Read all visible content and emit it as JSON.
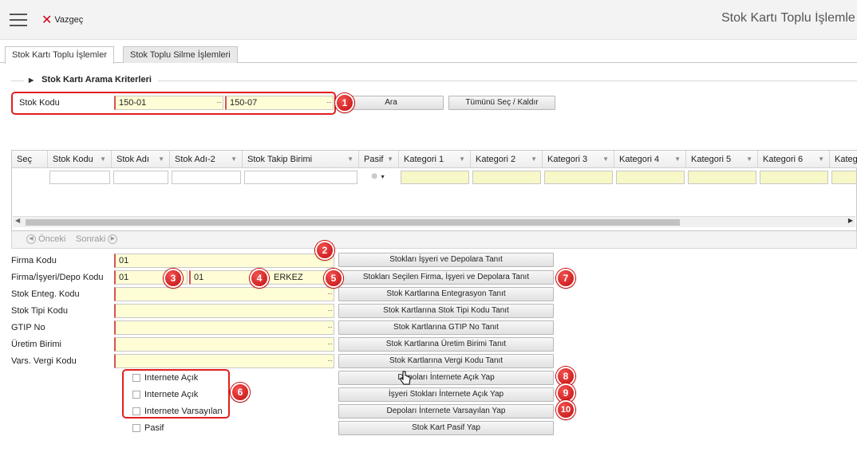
{
  "header": {
    "cancel_label": "Vazgeç",
    "title": "Stok Kartı Toplu İşlemle"
  },
  "tabs": [
    {
      "label": "Stok Kartı Toplu İşlemler",
      "active": true
    },
    {
      "label": "Stok Toplu Silme İşlemleri",
      "active": false
    }
  ],
  "search": {
    "section_title": "Stok Kartı Arama Kriterleri",
    "stok_kodu_label": "Stok Kodu",
    "stok_kodu_from": "150-01",
    "stok_kodu_to": "150-07",
    "search_button": "Ara",
    "select_all_button": "Tümünü Seç / Kaldır"
  },
  "grid": {
    "columns": [
      "Seç",
      "Stok Kodu",
      "Stok Adı",
      "Stok Adı-2",
      "Stok Takip Birimi",
      "Pasif",
      "Kategori 1",
      "Kategori 2",
      "Kategori 3",
      "Kategori 4",
      "Kategori 5",
      "Kategori 6",
      "Kateg"
    ],
    "prev_label": "Önceki",
    "next_label": "Sonraki"
  },
  "form": {
    "firma_kodu_label": "Firma Kodu",
    "firma_kodu_value": "01",
    "firma_isyeri_depo_label": "Firma/İşyeri/Depo Kodu",
    "firma_value": "01",
    "isyeri_value": "01",
    "depo_value": "ERKEZ",
    "stok_enteg_label": "Stok Enteg. Kodu",
    "stok_tipi_label": "Stok Tipi Kodu",
    "gtip_label": "GTIP No",
    "uretim_birimi_label": "Üretim Birimi",
    "vars_vergi_label": "Vars. Vergi Kodu"
  },
  "checkboxes": [
    "Internete Açık",
    "Internete Açık",
    "Internete Varsayılan",
    "Pasif"
  ],
  "actions": [
    "Stokları İşyeri ve Depolara Tanıt",
    "Stokları Seçilen Firma, İşyeri ve Depolara Tanıt",
    "Stok Kartlarına Entegrasyon Tanıt",
    "Stok Kartlarına Stok Tipi Kodu Tanıt",
    "Stok Kartlarına GTIP No Tanıt",
    "Stok Kartlarına Üretim Birimi Tanıt",
    "Stok Kartlarına Vergi Kodu Tanıt",
    "Depoları İnternete Açık Yap",
    "İşyeri Stokları İnternete Açık Yap",
    "Depoları İnternete Varsayılan Yap",
    "Stok Kart Pasif Yap"
  ],
  "badges": [
    "1",
    "2",
    "3",
    "4",
    "5",
    "6",
    "7",
    "8",
    "9",
    "10"
  ],
  "colors": {
    "highlight": "#e02020",
    "badge": "#d41818",
    "input_bg": "#fffdd6",
    "required_border": "#d9534f"
  }
}
